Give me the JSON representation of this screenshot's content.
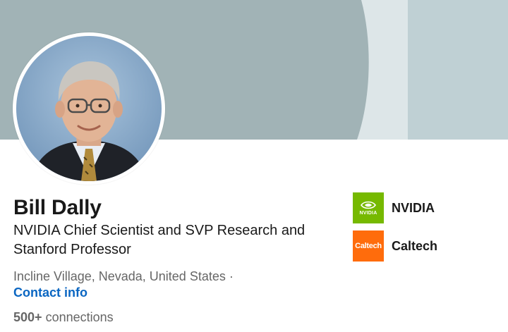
{
  "profile": {
    "name": "Bill Dally",
    "headline": "NVIDIA Chief Scientist and SVP Research and Stanford Professor",
    "location": "Incline Village, Nevada, United States",
    "separator": "·",
    "contact_label": "Contact info",
    "connections_count": "500+",
    "connections_label": "connections"
  },
  "organizations": [
    {
      "name": "NVIDIA",
      "logo_text": "NVIDIA",
      "logo_color": "#76b900"
    },
    {
      "name": "Caltech",
      "logo_text": "Caltech",
      "logo_color": "#ff6c0c"
    }
  ],
  "colors": {
    "banner_main": "#a1b3b6",
    "banner_light": "#dde6e8",
    "banner_right": "#bfd0d4",
    "link": "#0a66c2"
  },
  "icons": {
    "avatar": "profile-photo",
    "nvidia_logo": "nvidia-eye-logo"
  }
}
